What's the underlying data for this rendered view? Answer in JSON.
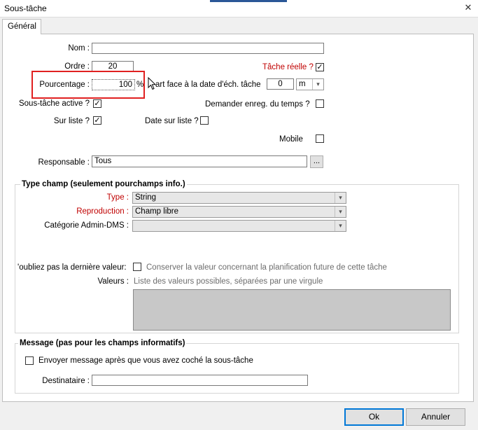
{
  "window": {
    "title": "Sous-tâche",
    "close_glyph": "✕"
  },
  "tabs": [
    {
      "label": "Général"
    }
  ],
  "form": {
    "nom_label": "Nom :",
    "nom_value": "",
    "ordre_label": "Ordre :",
    "ordre_value": "20",
    "tache_reelle_label": "Tâche réelle ?",
    "tache_reelle_checked": "✓",
    "pourcentage_label": "Pourcentage :",
    "pourcentage_value": "100",
    "pourcentage_unit": "%",
    "ecart_label": "art face à la date d'éch. tâche",
    "ecart_value": "0",
    "ecart_unit_value": "m",
    "sous_tache_active_label": "Sous-tâche active ?",
    "sous_tache_active_checked": "✓",
    "demander_enreg_label": "Demander enreg. du temps ?",
    "sur_liste_label": "Sur liste ?",
    "sur_liste_checked": "✓",
    "date_sur_liste_label": "Date sur liste ?",
    "mobile_label": "Mobile",
    "responsable_label": "Responsable :",
    "responsable_value": "Tous",
    "browse_label": "..."
  },
  "type_champ": {
    "title": "Type champ (seulement pourchamps info.)",
    "type_label": "Type :",
    "type_value": "String",
    "reproduction_label": "Reproduction :",
    "reproduction_value": "Champ libre",
    "categorie_label": "Catégorie Admin-DMS :",
    "categorie_value": "",
    "oubliez_label": "'oubliez pas la dernière valeur:",
    "conserver_label": "Conserver la valeur concernant la planification future de cette tâche",
    "valeurs_label": "Valeurs :",
    "valeurs_hint": "Liste des valeurs possibles, séparées par une virgule"
  },
  "message": {
    "title": "Message (pas pour les champs informatifs)",
    "envoyer_label": "Envoyer message après que vous avez coché la sous-tâche",
    "destinataire_label": "Destinataire :",
    "destinataire_value": ""
  },
  "footer": {
    "ok_label": "Ok",
    "annuler_label": "Annuler"
  },
  "colors": {
    "accent_red": "#c00000",
    "highlight_red": "#e02020",
    "focus_blue": "#0078d7"
  }
}
